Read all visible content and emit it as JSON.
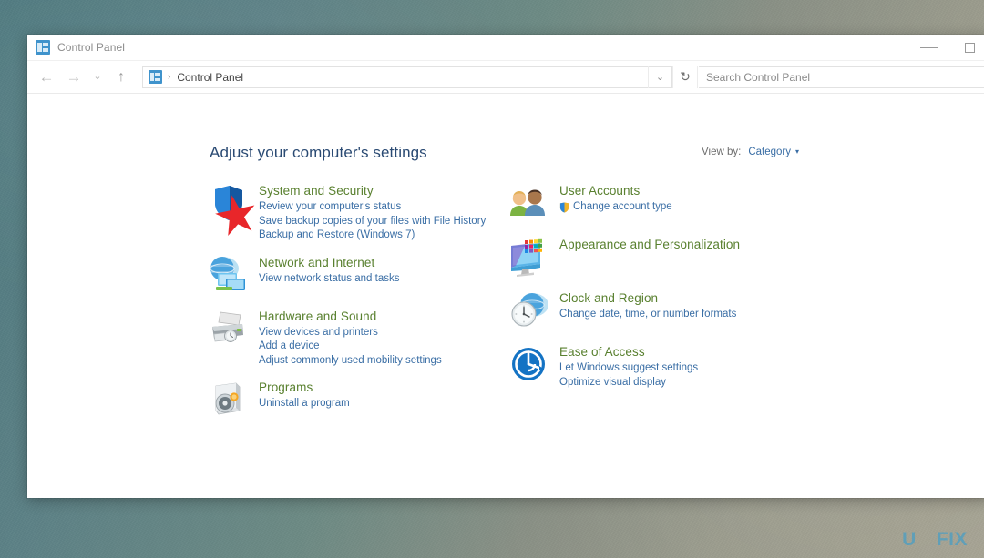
{
  "desktop": {
    "wallpaper_left_color": "#5d8287",
    "wallpaper_right_color": "#a6a393"
  },
  "watermark": {
    "left": "U",
    "right": "FIX",
    "color": "#4a9ec4"
  },
  "window": {
    "title": "Control Panel",
    "icon": "control-panel-icon",
    "caption": {
      "minimize_label": "Minimize",
      "maximize_label": "Maximize"
    }
  },
  "navbar": {
    "back_icon": "←",
    "forward_icon": "→",
    "recent_icon": "⌄",
    "up_icon": "↑",
    "address": {
      "icon": "control-panel-icon",
      "separator": "›",
      "text": "Control Panel"
    },
    "dropdown_icon": "⌄",
    "refresh_icon": "↻",
    "search_placeholder": "Search Control Panel"
  },
  "page": {
    "title": "Adjust your computer's settings",
    "view_by_label": "View by:",
    "view_by_value": "Category",
    "view_by_caret": "▾"
  },
  "categories": {
    "left": [
      {
        "icon": "security-shield-icon",
        "title": "System and Security",
        "links": [
          "Review your computer's status",
          "Save backup copies of your files with File History",
          "Backup and Restore (Windows 7)"
        ],
        "annotated": true
      },
      {
        "icon": "network-globe-icon",
        "title": "Network and Internet",
        "links": [
          "View network status and tasks"
        ],
        "annotated": false
      },
      {
        "icon": "printer-icon",
        "title": "Hardware and Sound",
        "links": [
          "View devices and printers",
          "Add a device",
          "Adjust commonly used mobility settings"
        ],
        "annotated": false
      },
      {
        "icon": "programs-disc-icon",
        "title": "Programs",
        "links": [
          "Uninstall a program"
        ],
        "annotated": false
      }
    ],
    "right": [
      {
        "icon": "user-accounts-icon",
        "title": "User Accounts",
        "links": [
          "Change account type"
        ],
        "shield_on_first_link": true
      },
      {
        "icon": "appearance-monitor-icon",
        "title": "Appearance and Personalization",
        "links": [],
        "shield_on_first_link": false
      },
      {
        "icon": "clock-region-icon",
        "title": "Clock and Region",
        "links": [
          "Change date, time, or number formats"
        ],
        "shield_on_first_link": false
      },
      {
        "icon": "ease-of-access-icon",
        "title": "Ease of Access",
        "links": [
          "Let Windows suggest settings",
          "Optimize visual display"
        ],
        "shield_on_first_link": false
      }
    ]
  },
  "annotation": {
    "shape": "red-star",
    "color": "#e8262a"
  }
}
